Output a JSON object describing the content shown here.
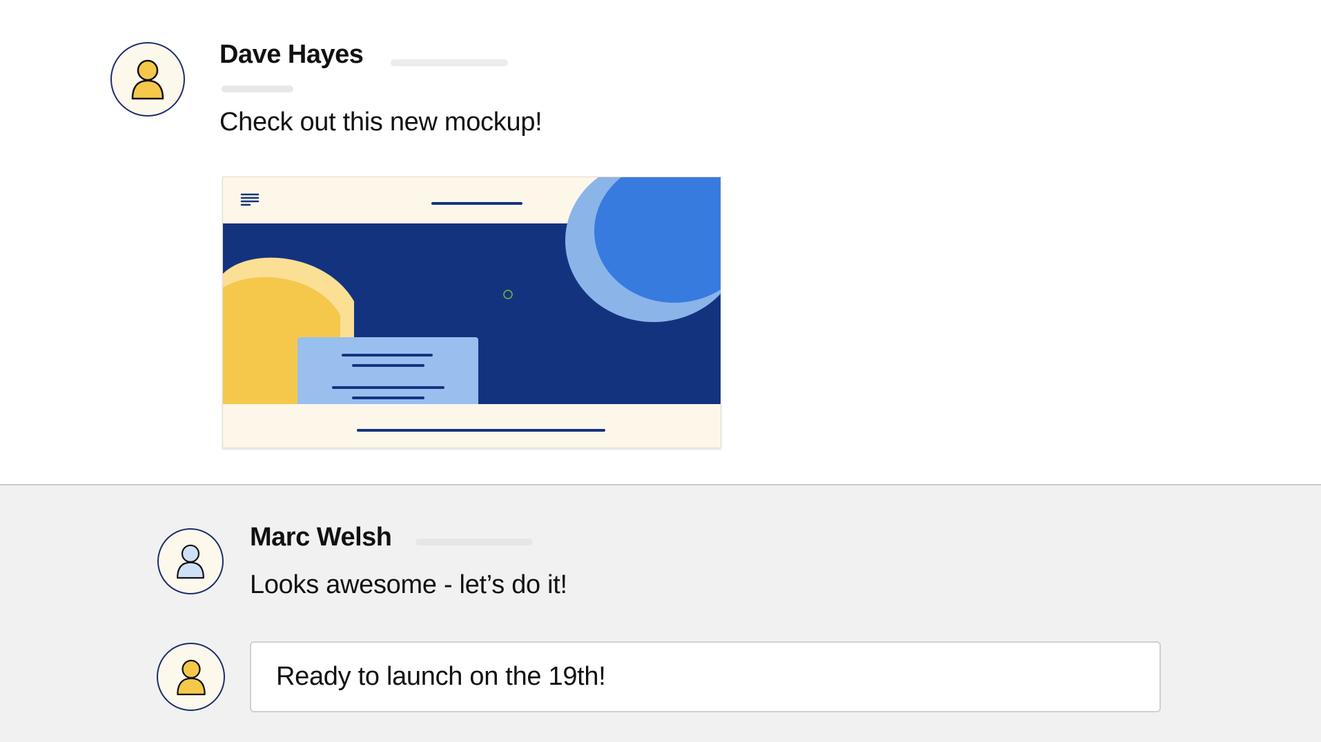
{
  "messages": [
    {
      "author": "Dave Hayes",
      "text": "Check out this new mockup!",
      "avatar_icon": "person-icon",
      "avatar_color": "#f5c84c",
      "attachment": {
        "type": "website-mockup",
        "icons": [
          "menu-icon"
        ],
        "colors": {
          "header_bg": "#fdf7ea",
          "hero_bg": "#14337f",
          "circle_bright": "#377bdf",
          "circle_light": "#8bb4e9",
          "sun_yellow": "#f5c84c",
          "sun_light": "#fadf95",
          "card_blue": "#98bfee",
          "line_navy": "#14337f"
        }
      }
    },
    {
      "author": "Marc Welsh",
      "text": "Looks awesome - let’s do it!",
      "avatar_icon": "person-icon",
      "avatar_color": "#cfe0f7"
    }
  ],
  "composer": {
    "value": "Ready to launch on the 19th!",
    "avatar_icon": "person-icon",
    "avatar_color": "#f5c84c"
  }
}
